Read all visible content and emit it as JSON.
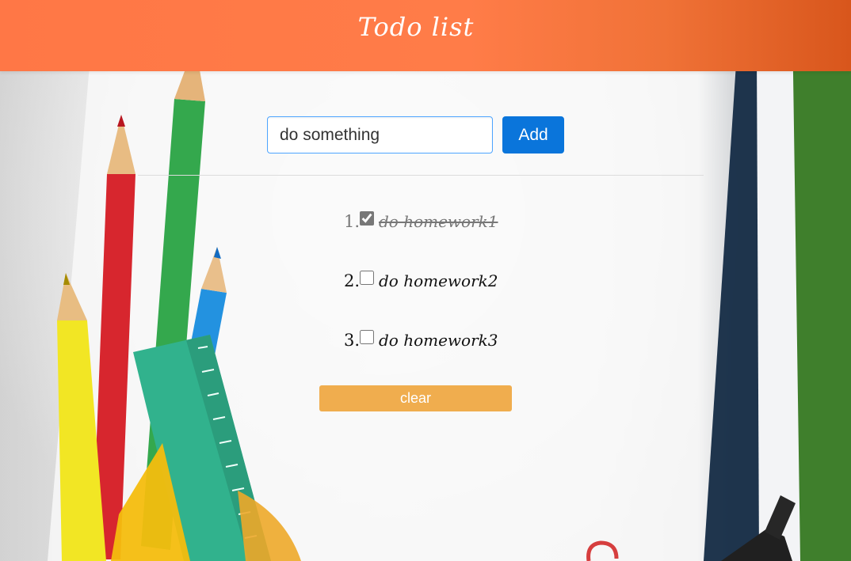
{
  "header": {
    "title": "Todo list"
  },
  "form": {
    "input_value": "do something",
    "add_label": "Add"
  },
  "todos": [
    {
      "number": "1.",
      "text": "do homework1",
      "checked": true
    },
    {
      "number": "2.",
      "text": "do homework2",
      "checked": false
    },
    {
      "number": "3.",
      "text": "do homework3",
      "checked": false
    }
  ],
  "actions": {
    "clear_label": "clear"
  },
  "colors": {
    "header_orange": "#ff7746",
    "add_blue": "#0a75db",
    "clear_orange": "#f0ad4e"
  }
}
